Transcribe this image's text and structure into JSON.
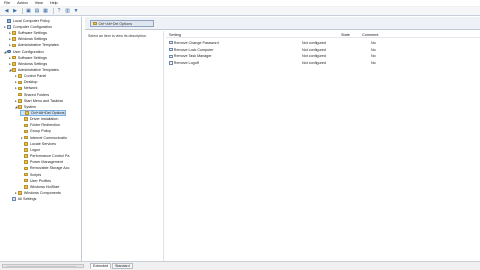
{
  "menu": [
    "File",
    "Action",
    "View",
    "Help"
  ],
  "toolbar": [
    "back-icon",
    "forward-icon",
    "up-folder-icon",
    "show-hide-tree-icon",
    "export-list-icon",
    "help-icon",
    "properties-icon",
    "filter-icon"
  ],
  "tree": {
    "items": [
      {
        "label": "Local Computer Policy",
        "icon": "policy",
        "expander": ""
      },
      {
        "label": "Computer Configuration",
        "icon": "computer",
        "expander": "▸"
      },
      {
        "label": "Software Settings",
        "icon": "folder",
        "expander": "▸"
      },
      {
        "label": "Windows Settings",
        "icon": "folder",
        "expander": "▸"
      },
      {
        "label": "Administrative Templates",
        "icon": "folder",
        "expander": "▸"
      },
      {
        "label": "User Configuration",
        "icon": "user",
        "expander": "◢"
      },
      {
        "label": "Software Settings",
        "icon": "folder",
        "expander": "▸"
      },
      {
        "label": "Windows Settings",
        "icon": "folder",
        "expander": "▸"
      },
      {
        "label": "Administrative Templates",
        "icon": "folder",
        "expander": "◢"
      },
      {
        "label": "Control Panel",
        "icon": "folder",
        "expander": "▸"
      },
      {
        "label": "Desktop",
        "icon": "folder",
        "expander": "▸"
      },
      {
        "label": "Network",
        "icon": "folder",
        "expander": "▸"
      },
      {
        "label": "Shared Folders",
        "icon": "folder",
        "expander": ""
      },
      {
        "label": "Start Menu and Taskbar",
        "icon": "folder",
        "expander": "▸"
      },
      {
        "label": "System",
        "icon": "folder",
        "expander": "◢"
      },
      {
        "label": "Ctrl+Alt+Del Options",
        "icon": "folder",
        "expander": "",
        "selected": true
      },
      {
        "label": "Driver Installation",
        "icon": "folder",
        "expander": ""
      },
      {
        "label": "Folder Redirection",
        "icon": "folder",
        "expander": ""
      },
      {
        "label": "Group Policy",
        "icon": "folder",
        "expander": ""
      },
      {
        "label": "Internet Communicatio",
        "icon": "folder",
        "expander": "▸"
      },
      {
        "label": "Locale Services",
        "icon": "folder",
        "expander": ""
      },
      {
        "label": "Logon",
        "icon": "folder",
        "expander": ""
      },
      {
        "label": "Performance Control Pa",
        "icon": "folder",
        "expander": ""
      },
      {
        "label": "Power Management",
        "icon": "folder",
        "expander": ""
      },
      {
        "label": "Removable Storage Acc",
        "icon": "folder",
        "expander": ""
      },
      {
        "label": "Scripts",
        "icon": "folder",
        "expander": ""
      },
      {
        "label": "User Profiles",
        "icon": "folder",
        "expander": ""
      },
      {
        "label": "Windows HotStart",
        "icon": "folder",
        "expander": ""
      },
      {
        "label": "Windows Components",
        "icon": "folder",
        "expander": "▸"
      },
      {
        "label": "All Settings",
        "icon": "settings",
        "expander": ""
      }
    ]
  },
  "details": {
    "folder_title": "Ctrl+Alt+Del Options",
    "description": "Select an item to view its description.",
    "columns": {
      "setting": "Setting",
      "state": "State",
      "comment": "Comment"
    },
    "rows": [
      {
        "setting": "Remove Change Password",
        "state": "Not configured",
        "comment": "No"
      },
      {
        "setting": "Remove Lock Computer",
        "state": "Not configured",
        "comment": "No"
      },
      {
        "setting": "Remove Task Manager",
        "state": "Not configured",
        "comment": "No"
      },
      {
        "setting": "Remove Logoff",
        "state": "Not configured",
        "comment": "No"
      }
    ]
  },
  "tabs": [
    "Extended",
    "Standard"
  ]
}
